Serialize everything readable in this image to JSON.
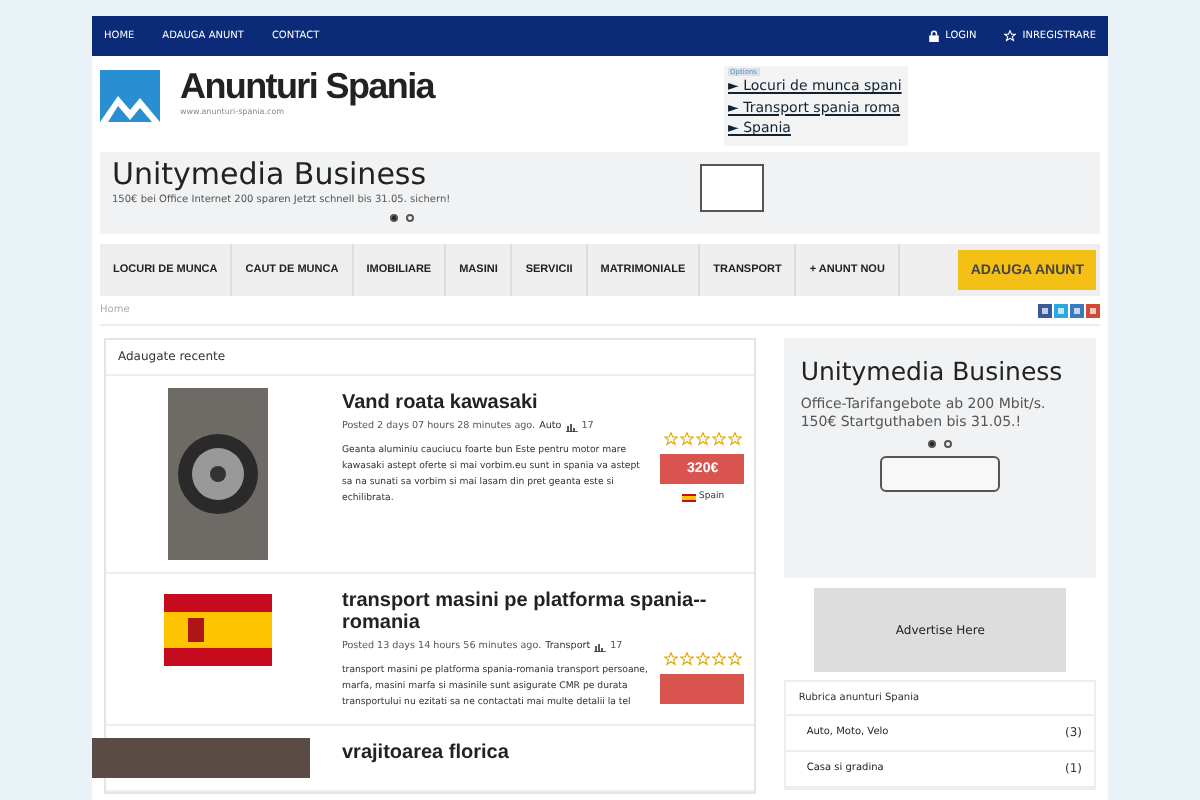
{
  "top_nav": {
    "left": [
      {
        "label": "HOME"
      },
      {
        "label": "ADAUGA ANUNT"
      },
      {
        "label": "CONTACT"
      }
    ],
    "right": [
      {
        "label": "LOGIN"
      },
      {
        "label": "INREGISTRARE"
      }
    ]
  },
  "header": {
    "title": "Anunturi Spania",
    "url": "www.anunturi-spania.com"
  },
  "ad_links": {
    "badge": "Options",
    "links": [
      "► Locuri de munca spani",
      "► Transport spania roma",
      "► Spania"
    ]
  },
  "banner_ad": {
    "title": "Unitymedia Business",
    "text": "150€ bei Office Internet 200 sparen Jetzt schnell bis 31.05. sichern!",
    "dots": [
      {
        "selected": true
      },
      {
        "selected": false
      }
    ]
  },
  "category_nav": {
    "items": [
      "LOCURI DE MUNCA",
      "CAUT DE MUNCA",
      "IMOBILIARE",
      "MASINI",
      "SERVICII",
      "MATRIMONIALE",
      "TRANSPORT",
      "+ ANUNT NOU"
    ],
    "button": "ADAUGA ANUNT"
  },
  "breadcrumb": "Home",
  "listings_panel": {
    "heading": "Adaugate recente",
    "listings": [
      {
        "title": "Vand roata kawasaki",
        "posted": "Posted 2 days 07 hours 28 minutes ago.",
        "category": "Auto",
        "views": "17",
        "description": "Geanta aluminiu cauciucu foarte bun Este pentru motor mare kawasaki astept oferte si mai vorbim.eu sunt in spania va astept sa na sunati sa vorbim si mai lasam din pret geanta este si echilibrata.",
        "stars": 0,
        "price": "320€",
        "location": "Spain"
      },
      {
        "title": "transport masini pe platforma spania--romania",
        "posted": "Posted 13 days 14 hours 56 minutes ago.",
        "category": "Transport",
        "views": "17",
        "description": "transport masini pe platforma spania-romania transport persoane, marfa, masini marfa si masinile sunt asigurate CMR pe durata transportului nu ezitati sa ne contactati mai multe detalii la tel",
        "stars": 0
      },
      {
        "title": "vrajitoarea florica"
      }
    ]
  },
  "sidebar": {
    "ad": {
      "title": "Unitymedia Business",
      "text": "Office-Tarifangebote ab 200 Mbit/s. 150€ Startguthaben bis 31.05.!",
      "dots": [
        {
          "selected": true
        },
        {
          "selected": false
        }
      ]
    },
    "advertise": "Advertise Here",
    "categories": {
      "heading": "Rubrica anunturi Spania",
      "items": [
        {
          "name": "Auto, Moto, Velo",
          "count": "(3)"
        },
        {
          "name": "Casa si gradina",
          "count": "(1)"
        }
      ]
    }
  }
}
